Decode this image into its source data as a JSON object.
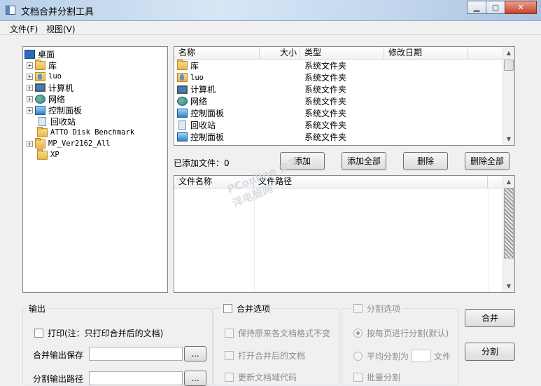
{
  "window": {
    "title": "文档合并分割工具",
    "minimize": "▁",
    "maximize": "▢",
    "close": "✕"
  },
  "menu": {
    "file": "文件(F)",
    "view": "视图(V)"
  },
  "tree": {
    "items": [
      {
        "label": "桌面",
        "icon": "desktop-icon",
        "expander": ""
      },
      {
        "label": "库",
        "icon": "library-folder-icon",
        "expander": "+"
      },
      {
        "label": "luo",
        "icon": "user-folder-icon",
        "expander": "+"
      },
      {
        "label": "计算机",
        "icon": "computer-icon",
        "expander": "+"
      },
      {
        "label": "网络",
        "icon": "network-icon",
        "expander": "+"
      },
      {
        "label": "控制面板",
        "icon": "control-panel-icon",
        "expander": "+"
      },
      {
        "label": "回收站",
        "icon": "recycle-bin-icon",
        "expander": ""
      },
      {
        "label": "ATTO Disk Benchmark",
        "icon": "folder-icon",
        "expander": ""
      },
      {
        "label": "MP_Ver2162_All",
        "icon": "folder-icon",
        "expander": "+"
      },
      {
        "label": "XP",
        "icon": "folder-icon",
        "expander": ""
      }
    ]
  },
  "filelist": {
    "headers": {
      "name": "名称",
      "size": "大小",
      "type": "类型",
      "date": "修改日期"
    },
    "rows": [
      {
        "name": "库",
        "type": "系统文件夹",
        "icon": "library-folder-icon"
      },
      {
        "name": "luo",
        "type": "系统文件夹",
        "icon": "user-folder-icon"
      },
      {
        "name": "计算机",
        "type": "系统文件夹",
        "icon": "computer-icon"
      },
      {
        "name": "网络",
        "type": "系统文件夹",
        "icon": "network-icon"
      },
      {
        "name": "控制面板",
        "type": "系统文件夹",
        "icon": "control-panel-icon"
      },
      {
        "name": "回收站",
        "type": "系统文件夹",
        "icon": "recycle-bin-icon"
      },
      {
        "name": "控制面板",
        "type": "系统文件夹",
        "icon": "control-panel-icon"
      }
    ]
  },
  "actions": {
    "added_count": "已添加文件：0",
    "add": "添加",
    "add_all": "添加全部",
    "delete": "删除",
    "delete_all": "删除全部"
  },
  "added_list": {
    "headers": {
      "name": "文件名称",
      "path": "文件路径"
    }
  },
  "output": {
    "title": "输出",
    "print_label": "打印(注：只打印合并后的文档)",
    "merge_path_label": "合并输出保存",
    "split_path_label": "分割输出路径",
    "browse": "..."
  },
  "merge_options": {
    "title": "合并选项",
    "keep_format": "保持原来各文档格式不变",
    "open_after": "打开合并后的文档",
    "update_field": "更新文档域代码"
  },
  "split_options": {
    "title": "分割选项",
    "by_page": "按每页进行分割(默认)",
    "avg_prefix": "平均分割为",
    "avg_suffix": "文件",
    "batch": "批量分割"
  },
  "buttons": {
    "merge": "合并",
    "split": "分割"
  },
  "watermark": "PConline 太平洋电脑网"
}
